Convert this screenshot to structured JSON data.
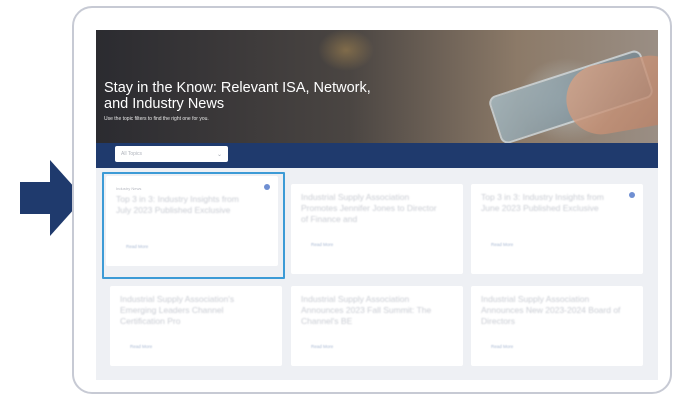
{
  "hero": {
    "title": "Stay in the Know: Relevant ISA, Network, and Industry News",
    "subtitle": "Use the topic filters to find the right one for you."
  },
  "filter": {
    "selected": "All Topics"
  },
  "cards": [
    {
      "eyebrow": "Industry News",
      "title": "Top 3 in 3: Industry Insights from July 2023 Published Exclusive",
      "link": "Read More",
      "bookmarked": true
    },
    {
      "eyebrow": "",
      "title": "Industrial Supply Association Promotes Jennifer Jones to Director of Finance and",
      "link": "Read More",
      "bookmarked": false
    },
    {
      "eyebrow": "",
      "title": "Top 3 in 3: Industry Insights from June 2023 Published Exclusive",
      "link": "Read More",
      "bookmarked": true
    },
    {
      "eyebrow": "",
      "title": "Industrial Supply Association's Emerging Leaders Channel Certification Pro",
      "link": "Read More",
      "bookmarked": false
    },
    {
      "eyebrow": "",
      "title": "Industrial Supply Association Announces 2023 Fall Summit: The Channel's BE",
      "link": "Read More",
      "bookmarked": false
    },
    {
      "eyebrow": "",
      "title": "Industrial Supply Association Announces New 2023-2024 Board of Directors",
      "link": "Read More",
      "bookmarked": false
    }
  ],
  "colors": {
    "accent": "#1f3a6d",
    "highlight": "#3d9bd6",
    "arrow": "#1f3a6d"
  }
}
